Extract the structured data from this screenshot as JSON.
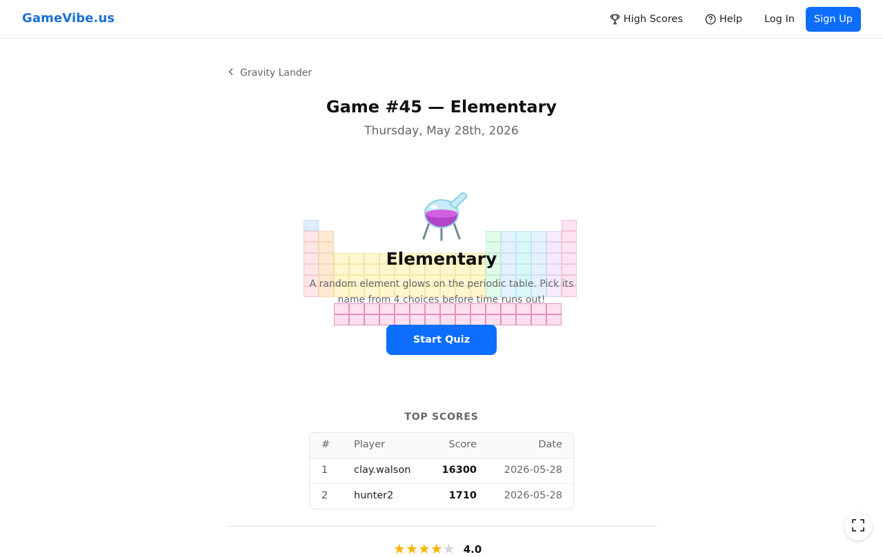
{
  "brand": "GameVibe.us",
  "nav": {
    "high_scores": "High Scores",
    "help": "Help",
    "login": "Log In",
    "signup": "Sign Up"
  },
  "breadcrumb": {
    "back_label": "Gravity Lander"
  },
  "page": {
    "title": "Game #45 — Elementary",
    "date": "Thursday, May 28th, 2026"
  },
  "game": {
    "name": "Elementary",
    "description": "A random element glows on the periodic table. Pick its name from 4 choices before time runs out!",
    "start_label": "Start Quiz",
    "icon": "flask-icon"
  },
  "scores": {
    "heading": "TOP SCORES",
    "columns": [
      "#",
      "Player",
      "Score",
      "Date"
    ],
    "rows": [
      {
        "rank": "1",
        "player": "clay.walson",
        "score": "16300",
        "date": "2026-05-28"
      },
      {
        "rank": "2",
        "player": "hunter2",
        "score": "1710",
        "date": "2026-05-28"
      }
    ]
  },
  "rating": {
    "value": "4.0",
    "stars": 4,
    "max": 5
  },
  "colors": {
    "brand": "#1a6fd6",
    "primary": "#0d6efd",
    "star": "#f5b400"
  }
}
